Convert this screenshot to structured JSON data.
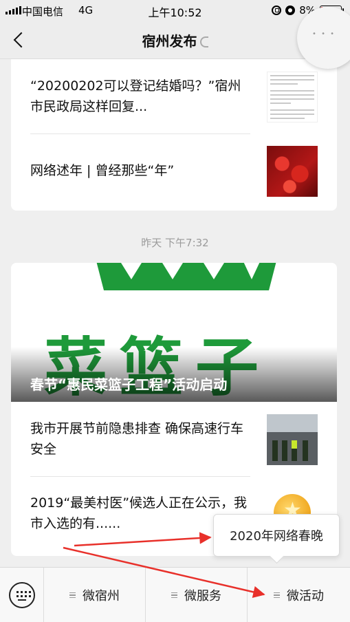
{
  "status_bar": {
    "carrier": "中国电信",
    "network": "4G",
    "time": "上午10:52",
    "battery": "8%",
    "battery_level": 0.08
  },
  "nav": {
    "title": "宿州发布"
  },
  "feed": {
    "card1": {
      "articles": [
        {
          "title": "“20200202可以登记结婚吗？”宿州市民政局这样回复..."
        },
        {
          "title": "网络述年 | 曾经那些“年”"
        }
      ]
    },
    "timestamp": "昨天 下午7:32",
    "card2": {
      "cover_image_text": "菜篮子",
      "cover_title": "春节“惠民菜篮子工程”活动启动",
      "articles": [
        {
          "title": "我市开展节前隐患排查 确保高速行车安全"
        },
        {
          "title": "2019“最美村医”候选人正在公示，我市入选的有......"
        }
      ]
    }
  },
  "menu": {
    "items": [
      {
        "label": "微宿州"
      },
      {
        "label": "微服务"
      },
      {
        "label": "微活动"
      }
    ],
    "popup_item": "2020年网络春晚"
  },
  "colors": {
    "accent_green": "#1e9a3a",
    "annotation_red": "#e8302a",
    "battery_low": "#e02020"
  }
}
